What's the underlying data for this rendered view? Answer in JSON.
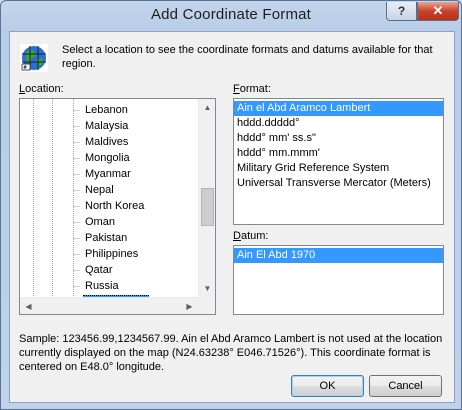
{
  "window": {
    "title": "Add Coordinate Format",
    "help_label": "?",
    "close_label": "✕"
  },
  "intro_text": "Select a location to see the coordinate formats and datums available for that region.",
  "location": {
    "label_pre": "",
    "label_key": "L",
    "label_post": "ocation:",
    "items": [
      "Lebanon",
      "Malaysia",
      "Maldives",
      "Mongolia",
      "Myanmar",
      "Nepal",
      "North Korea",
      "Oman",
      "Pakistan",
      "Philippines",
      "Qatar",
      "Russia",
      "Saudi Arabia"
    ],
    "selected": "Saudi Arabia"
  },
  "format": {
    "label_key": "F",
    "label_post": "ormat:",
    "items": [
      "Ain el Abd Aramco Lambert",
      "hddd.ddddd°",
      "hddd° mm' ss.s\"",
      "hddd° mm.mmm'",
      "Military Grid Reference System",
      "Universal Transverse Mercator (Meters)"
    ],
    "selected": "Ain el Abd Aramco Lambert"
  },
  "datum": {
    "label_key": "D",
    "label_post": "atum:",
    "items": [
      "Ain El Abd 1970"
    ],
    "selected": "Ain El Abd 1970"
  },
  "sample_text": "Sample: 123456.99,1234567.99.  Ain el Abd Aramco Lambert is not used at the location currently displayed on the map (N24.63238°  E046.71526°).  This coordinate format is centered on E48.0° longitude.",
  "buttons": {
    "ok": "OK",
    "cancel": "Cancel"
  },
  "colors": {
    "selection": "#3399ff",
    "close_button": "#c9432c"
  },
  "icons": {
    "app": "globe-grid-icon"
  }
}
